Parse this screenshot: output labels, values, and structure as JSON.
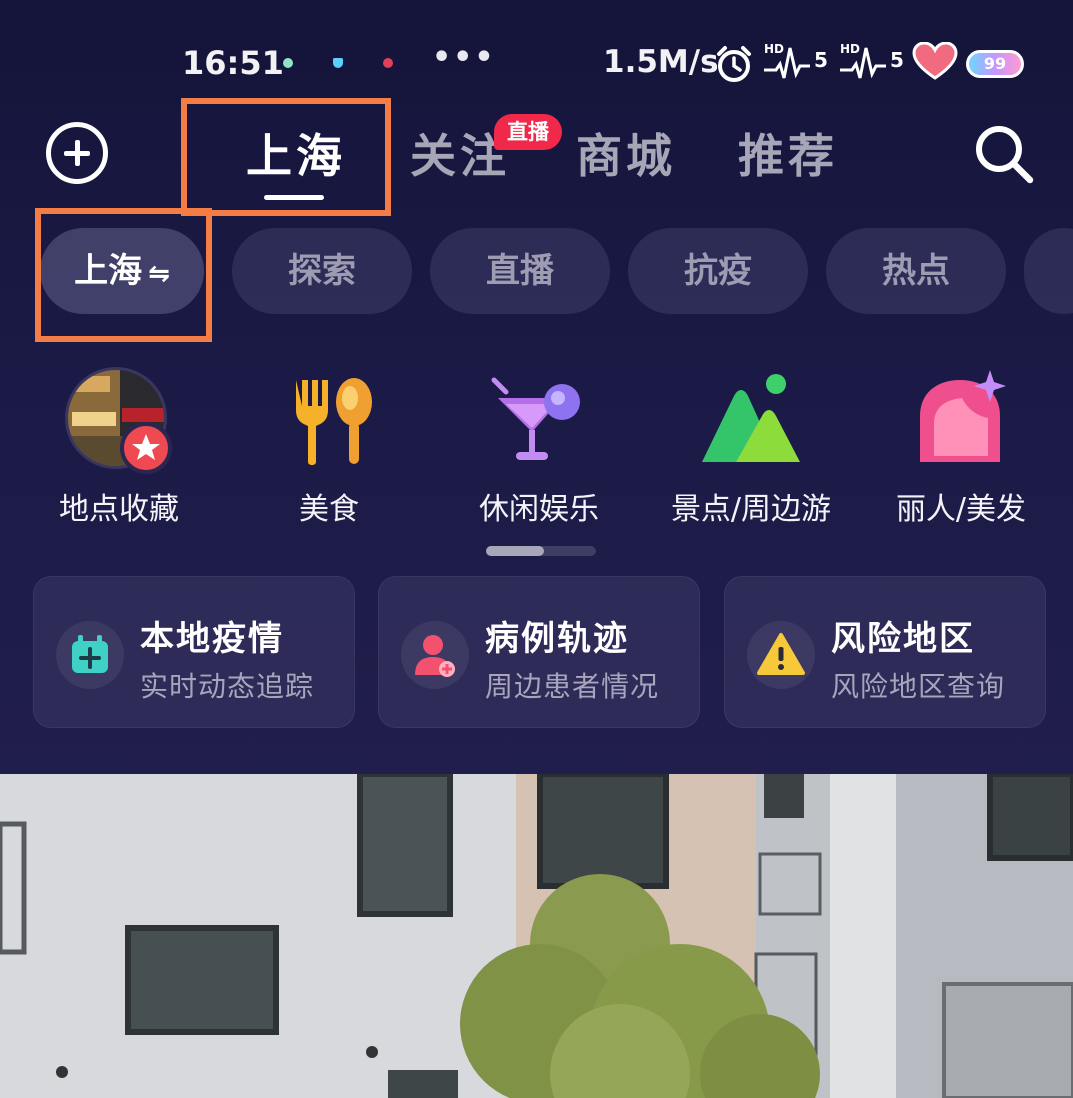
{
  "status_bar": {
    "time": "16:51",
    "ellipsis": "•••",
    "net_speed": "1.5M/s",
    "hd_label": "HD",
    "signal_1": "5",
    "signal_2": "5",
    "battery": "99",
    "icons": [
      "alarm-icon",
      "signal-hd-icon",
      "signal-hd-icon",
      "heart-icon",
      "battery-icon"
    ]
  },
  "top_nav": {
    "tabs": [
      {
        "label": "上海"
      },
      {
        "label": "关注"
      },
      {
        "label": "商城"
      },
      {
        "label": "推荐"
      }
    ],
    "live_badge": "直播",
    "icons": [
      "plus-icon",
      "search-icon"
    ]
  },
  "sub_tabs": [
    {
      "label": "上海",
      "swap": "⇋"
    },
    {
      "label": "探索"
    },
    {
      "label": "直播"
    },
    {
      "label": "抗疫"
    },
    {
      "label": "热点"
    }
  ],
  "categories": [
    {
      "label": "地点收藏",
      "icon": "saved-place-icon"
    },
    {
      "label": "美食",
      "icon": "fork-spoon-icon"
    },
    {
      "label": "休闲娱乐",
      "icon": "cocktail-icon"
    },
    {
      "label": "景点/周边游",
      "icon": "mountain-icon"
    },
    {
      "label": "丽人/美发",
      "icon": "beauty-icon"
    }
  ],
  "cards": [
    {
      "title": "本地疫情",
      "subtitle": "实时动态追踪",
      "icon": "calendar-plus-icon",
      "icon_color": "#3fd0c6"
    },
    {
      "title": "病例轨迹",
      "subtitle": "周边患者情况",
      "icon": "patient-icon",
      "icon_color": "#f2526e"
    },
    {
      "title": "风险地区",
      "subtitle": "风险地区查询",
      "icon": "warning-icon",
      "icon_color": "#f6c83a"
    }
  ],
  "colors": {
    "highlight": "#f47c45",
    "live_badge": "#f0284a",
    "background": "#1c1b48"
  }
}
